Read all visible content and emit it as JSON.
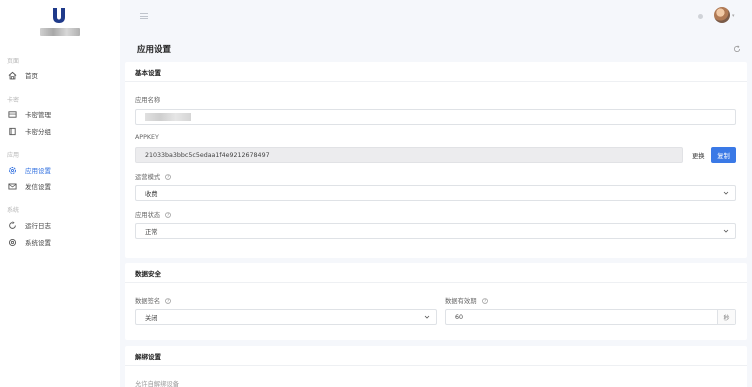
{
  "sidebar": {
    "groups": [
      {
        "label": "页面",
        "items": [
          {
            "label": "首页",
            "icon": "home-icon"
          }
        ]
      },
      {
        "label": "卡密",
        "items": [
          {
            "label": "卡密管理",
            "icon": "card-icon"
          },
          {
            "label": "卡密分组",
            "icon": "folder-icon"
          }
        ]
      },
      {
        "label": "应用",
        "items": [
          {
            "label": "应用设置",
            "icon": "gear-icon",
            "active": true
          },
          {
            "label": "发信设置",
            "icon": "mail-icon"
          }
        ]
      },
      {
        "label": "系统",
        "items": [
          {
            "label": "运行日志",
            "icon": "log-icon"
          },
          {
            "label": "系统设置",
            "icon": "settings-icon"
          }
        ]
      }
    ],
    "accent_color": "#2f6fe0"
  },
  "page": {
    "title": "应用设置"
  },
  "basic": {
    "title": "基本设置",
    "app_name_label": "应用名称",
    "appkey_label": "APPKEY",
    "appkey_value": "21033ba3bbc5c5edaa1f4e9212678497",
    "change_label": "更换",
    "copy_label": "复制",
    "mode_label": "运营模式",
    "mode_value": "收费",
    "status_label": "应用状态",
    "status_value": "正常"
  },
  "security": {
    "title": "数据安全",
    "sign_label": "数据签名",
    "sign_value": "关闭",
    "validity_label": "数据有效期",
    "validity_value": "60",
    "validity_unit": "秒"
  },
  "unbind": {
    "title": "解绑设置",
    "allow_label": "允许自解绑设备"
  },
  "colors": {
    "primary": "#3a79e6",
    "background": "#f5f7fb"
  }
}
